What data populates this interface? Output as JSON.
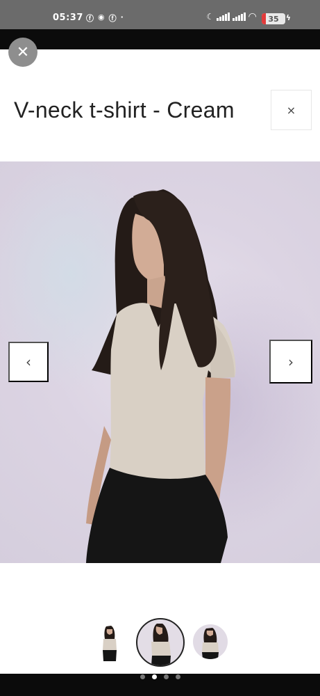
{
  "status_bar": {
    "time": "05:37",
    "battery": "35",
    "icons": [
      "facebook-icon",
      "messenger-icon",
      "facebook-icon",
      "alarm-icon",
      "signal-icon",
      "wifi-icon",
      "battery-icon"
    ]
  },
  "modal": {
    "title": "V-neck t-shirt - Cream",
    "close_symbol": "×",
    "corner_close_symbol": "✕"
  },
  "gallery": {
    "prev_symbol": "‹",
    "next_symbol": "›",
    "thumbnail_count": 3,
    "active_index": 1,
    "pager_dots": 4,
    "active_dot": 1
  },
  "colors": {
    "shirt": "#d9d0c5",
    "pants": "#151515",
    "hair": "#241b17",
    "background": "#dcd4e3"
  }
}
